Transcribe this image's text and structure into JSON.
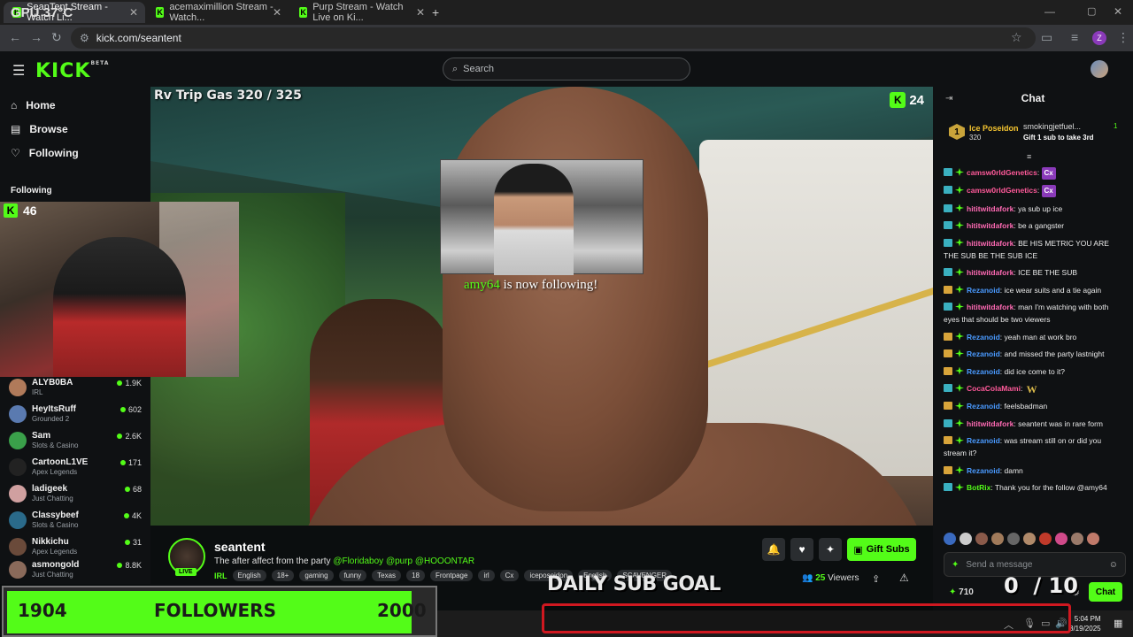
{
  "browser": {
    "tabs": [
      {
        "label": "SeanTent Stream - Watch Li..."
      },
      {
        "label": "acemaximillion Stream - Watch..."
      },
      {
        "label": "Purp Stream - Watch Live on Ki..."
      }
    ],
    "url": "kick.com/seantent",
    "gpu_overlay": "GPU 37°C"
  },
  "header": {
    "logo": "KICK",
    "logo_beta": "BETA",
    "search_placeholder": "Search"
  },
  "sidebar": {
    "nav": [
      {
        "label": "Home"
      },
      {
        "label": "Browse"
      },
      {
        "label": "Following"
      }
    ],
    "following_heading": "Following",
    "channels": [
      {
        "name": "ALYB0BA",
        "category": "IRL",
        "viewers": "1.9K",
        "color": "#b07a5a"
      },
      {
        "name": "HeyItsRuff",
        "category": "Grounded 2",
        "viewers": "602",
        "color": "#5a7ab0"
      },
      {
        "name": "Sam",
        "category": "Slots & Casino",
        "viewers": "2.6K",
        "color": "#3aa04a"
      },
      {
        "name": "CartoonL1VE",
        "category": "Apex Legends",
        "viewers": "171",
        "color": "#222222"
      },
      {
        "name": "ladigeek",
        "category": "Just Chatting",
        "viewers": "68",
        "color": "#d0a0a0"
      },
      {
        "name": "Classybeef",
        "category": "Slots & Casino",
        "viewers": "4K",
        "color": "#2a6a8a"
      },
      {
        "name": "Nikkichu",
        "category": "Apex Legends",
        "viewers": "31",
        "color": "#6a4a3a"
      },
      {
        "name": "asmongold",
        "category": "Just Chatting",
        "viewers": "8.8K",
        "color": "#8a6a5a"
      }
    ]
  },
  "webcam": {
    "kick_count": "46"
  },
  "video": {
    "overlay_text": "Rv Trip Gas  320 / 325",
    "badge_count": "24",
    "alert_user": "amy64",
    "alert_text": " is now following!"
  },
  "stream": {
    "name": "seantent",
    "live": "LIVE",
    "title": "The after affect from the party",
    "mentions": "@Floridaboy @purp @HOOONTAR",
    "category": "IRL",
    "tags": [
      "English",
      "18+",
      "gaming",
      "funny",
      "Texas",
      "18",
      "Frontpage",
      "irl",
      "Cx",
      "iceposeidon",
      "English",
      "SCAVENGER"
    ],
    "viewers": "25",
    "viewers_label": " Viewers",
    "gift_label": "Gift Subs"
  },
  "chat": {
    "title": "Chat",
    "pinned": {
      "rank": "1",
      "user1": "Ice Poseidon",
      "value1": "320",
      "user2": "smokingjetfuel...",
      "value2": "1",
      "goal": "Gift 1 sub to take 3rd"
    },
    "messages": [
      {
        "user": "camsw0rldGenetics",
        "text": "",
        "color": "#ff5a9a",
        "emote": "Cx"
      },
      {
        "user": "camsw0rldGenetics",
        "text": "",
        "color": "#ff5a9a",
        "emote": "Cx"
      },
      {
        "user": "hititwitdafork",
        "text": "ya sub up ice",
        "color": "#ff6ab4"
      },
      {
        "user": "hititwitdafork",
        "text": "be a gangster",
        "color": "#ff6ab4"
      },
      {
        "user": "hititwitdafork",
        "text": "BE HIS METRIC YOU ARE THE SUB BE THE SUB ICE",
        "color": "#ff6ab4"
      },
      {
        "user": "hititwitdafork",
        "text": "ICE BE THE SUB",
        "color": "#ff6ab4"
      },
      {
        "user": "Rezanoid",
        "text": "ice wear suits and a tie again",
        "color": "#4a9aff"
      },
      {
        "user": "hititwitdafork",
        "text": "man I'm watching with both eyes that should be two viewers",
        "color": "#ff6ab4"
      },
      {
        "user": "Rezanoid",
        "text": "yeah man at work bro",
        "color": "#4a9aff"
      },
      {
        "user": "Rezanoid",
        "text": "and missed the party lastnight",
        "color": "#4a9aff"
      },
      {
        "user": "Rezanoid",
        "text": "did ice come to it?",
        "color": "#4a9aff"
      },
      {
        "user": "CocaColaMami",
        "text": "",
        "color": "#ff5a9a",
        "emote": "W"
      },
      {
        "user": "Rezanoid",
        "text": "feelsbadman",
        "color": "#4a9aff"
      },
      {
        "user": "hititwitdafork",
        "text": "seantent was in rare form",
        "color": "#ff6ab4"
      },
      {
        "user": "Rezanoid",
        "text": "was stream still on or did you stream it?",
        "color": "#4a9aff"
      },
      {
        "user": "Rezanoid",
        "text": "damn",
        "color": "#4a9aff"
      },
      {
        "user": "BotRix",
        "text": "Thank you for the follow @amy64",
        "color": "#53fc18"
      }
    ],
    "input_placeholder": "Send a message",
    "kicks": "710",
    "chat_button": "Chat"
  },
  "overlays": {
    "follow_current": "1904",
    "follow_label": "FOLLOWERS",
    "follow_target": "2000",
    "follow_progress": 0.952,
    "daily_label": "DAILY SUB GOAL",
    "sub_current": "0",
    "sub_sep": "/",
    "sub_target": "10"
  },
  "taskbar": {
    "time": "5:04 PM",
    "date": "8/19/2025"
  }
}
